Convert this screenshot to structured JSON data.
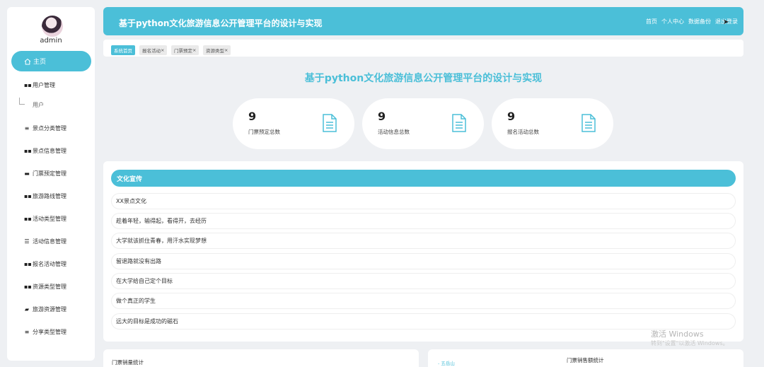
{
  "sidebar": {
    "username": "admin",
    "home_label": "主页",
    "items": [
      {
        "label": "用户管理",
        "icon": "grid-icon"
      },
      {
        "label": "景点分类管理",
        "icon": "list-icon"
      },
      {
        "label": "景点信息管理",
        "icon": "grid-icon"
      },
      {
        "label": "门票预定管理",
        "icon": "monitor-icon"
      },
      {
        "label": "旅游路线管理",
        "icon": "grid-icon"
      },
      {
        "label": "活动类型管理",
        "icon": "grid-icon"
      },
      {
        "label": "活动信息管理",
        "icon": "sliders-icon"
      },
      {
        "label": "报名活动管理",
        "icon": "grid-icon"
      },
      {
        "label": "资源类型管理",
        "icon": "grid-icon"
      },
      {
        "label": "旅游资源管理",
        "icon": "folder-icon"
      },
      {
        "label": "分享类型管理",
        "icon": "list-icon"
      }
    ],
    "subitem": "用户"
  },
  "header": {
    "title": "基于python文化旅游信息公开管理平台的设计与实现",
    "links": [
      "首页",
      "个人中心",
      "数据备份",
      "退出登录"
    ]
  },
  "tabs": [
    {
      "label": "系统首页",
      "closable": false
    },
    {
      "label": "报名活动",
      "closable": true
    },
    {
      "label": "门票预定",
      "closable": true
    },
    {
      "label": "资源类型",
      "closable": true
    }
  ],
  "main": {
    "title": "基于python文化旅游信息公开管理平台的设计与实现",
    "stats": [
      {
        "value": "9",
        "label": "门票预定总数"
      },
      {
        "value": "9",
        "label": "活动信息总数"
      },
      {
        "value": "9",
        "label": "报名活动总数"
      }
    ]
  },
  "culture": {
    "title": "文化宣传",
    "items": [
      "XX景点文化",
      "趁着年轻，输得起，看得开，去经历",
      "大学就该抓住青春，用汗水实现梦想",
      "留退路就没有出路",
      "在大学给自己定个目标",
      "做个真正的学生",
      "远大的目标是成功的磁石"
    ]
  },
  "watermark": {
    "line1": "激活 Windows",
    "line2": "转到\"设置\"以激活 Windows。"
  },
  "bottom": {
    "left_title": "门票销量统计",
    "right_legend": "- 五岳山",
    "right_title": "门票销售额统计"
  },
  "colors": {
    "accent": "#4bbfd8",
    "background": "#eef0f3"
  }
}
